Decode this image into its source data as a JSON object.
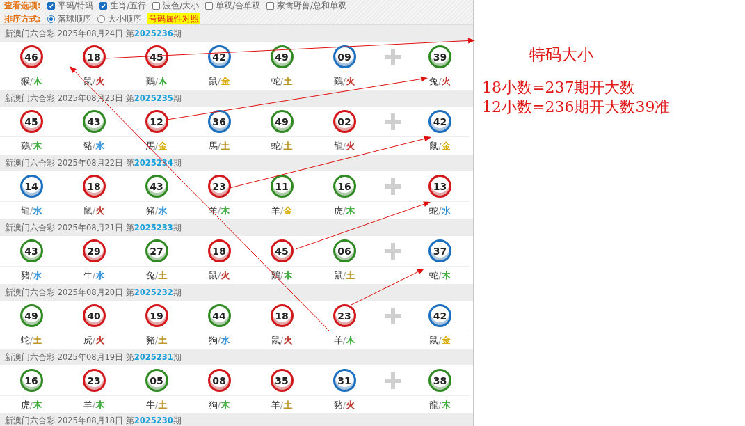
{
  "options": {
    "view_label": "查看选项:",
    "view_options": [
      {
        "label": "平码/特码",
        "checked": true
      },
      {
        "label": "生肖/五行",
        "checked": true
      },
      {
        "label": "波色/大小",
        "checked": false
      },
      {
        "label": "单双/合单双",
        "checked": false
      },
      {
        "label": "家禽野兽/总和单双",
        "checked": false
      }
    ],
    "sort_label": "排序方式:",
    "sort_options": [
      {
        "label": "落球顺序",
        "selected": true
      },
      {
        "label": "大小顺序",
        "selected": false
      }
    ],
    "reference_link": "号码属性对照"
  },
  "draws": [
    {
      "title": "新澳门六合彩 2025年08月24日 ",
      "issue_prefix": "第",
      "issue": "2025236",
      "issue_suffix": "期",
      "balls": [
        {
          "number": "46",
          "color": "#d3181c",
          "zodiac": "猴",
          "separator": "/",
          "element": {
            "text": "木",
            "color": "#3fae3f"
          }
        },
        {
          "number": "18",
          "color": "#d3181c",
          "zodiac": "鼠",
          "separator": "/",
          "element": {
            "text": "火",
            "color": "#c0302a"
          }
        },
        {
          "number": "45",
          "color": "#d3181c",
          "zodiac": "鷄",
          "separator": "/",
          "element": {
            "text": "木",
            "color": "#3fae3f"
          }
        },
        {
          "number": "42",
          "color": "#1b6fbf",
          "zodiac": "鼠",
          "separator": "/",
          "element": {
            "text": "金",
            "color": "#d9a900"
          }
        },
        {
          "number": "49",
          "color": "#2f8a22",
          "zodiac": "蛇",
          "separator": "/",
          "element": {
            "text": "土",
            "color": "#b8921c"
          }
        },
        {
          "number": "09",
          "color": "#1b6fbf",
          "zodiac": "鷄",
          "separator": "/",
          "element": {
            "text": "火",
            "color": "#c0302a"
          }
        }
      ],
      "special": {
        "number": "39",
        "color": "#2f8a22",
        "zodiac": "兔",
        "separator": "/",
        "element": {
          "text": "火",
          "color": "#c0302a"
        }
      }
    },
    {
      "title": "新澳门六合彩 2025年08月23日 ",
      "issue_prefix": "第",
      "issue": "2025235",
      "issue_suffix": "期",
      "balls": [
        {
          "number": "45",
          "color": "#d3181c",
          "zodiac": "鷄",
          "separator": "/",
          "element": {
            "text": "木",
            "color": "#3fae3f"
          }
        },
        {
          "number": "43",
          "color": "#2f8a22",
          "zodiac": "豬",
          "separator": "/",
          "element": {
            "text": "水",
            "color": "#2f8fd8"
          }
        },
        {
          "number": "12",
          "color": "#d3181c",
          "zodiac": "馬",
          "separator": "/",
          "element": {
            "text": "金",
            "color": "#d9a900"
          }
        },
        {
          "number": "36",
          "color": "#1b6fbf",
          "zodiac": "馬",
          "separator": "/",
          "element": {
            "text": "土",
            "color": "#b8921c"
          }
        },
        {
          "number": "49",
          "color": "#2f8a22",
          "zodiac": "蛇",
          "separator": "/",
          "element": {
            "text": "土",
            "color": "#b8921c"
          }
        },
        {
          "number": "02",
          "color": "#d3181c",
          "zodiac": "龍",
          "separator": "/",
          "element": {
            "text": "火",
            "color": "#c0302a"
          }
        }
      ],
      "special": {
        "number": "42",
        "color": "#1b6fbf",
        "zodiac": "鼠",
        "separator": "/",
        "element": {
          "text": "金",
          "color": "#d9a900"
        }
      }
    },
    {
      "title": "新澳门六合彩 2025年08月22日 ",
      "issue_prefix": "第",
      "issue": "2025234",
      "issue_suffix": "期",
      "balls": [
        {
          "number": "14",
          "color": "#1b6fbf",
          "zodiac": "龍",
          "separator": "/",
          "element": {
            "text": "水",
            "color": "#2f8fd8"
          }
        },
        {
          "number": "18",
          "color": "#d3181c",
          "zodiac": "鼠",
          "separator": "/",
          "element": {
            "text": "火",
            "color": "#c0302a"
          }
        },
        {
          "number": "43",
          "color": "#2f8a22",
          "zodiac": "豬",
          "separator": "/",
          "element": {
            "text": "水",
            "color": "#2f8fd8"
          }
        },
        {
          "number": "23",
          "color": "#d3181c",
          "zodiac": "羊",
          "separator": "/",
          "element": {
            "text": "木",
            "color": "#3fae3f"
          }
        },
        {
          "number": "11",
          "color": "#2f8a22",
          "zodiac": "羊",
          "separator": "/",
          "element": {
            "text": "金",
            "color": "#d9a900"
          }
        },
        {
          "number": "16",
          "color": "#2f8a22",
          "zodiac": "虎",
          "separator": "/",
          "element": {
            "text": "木",
            "color": "#3fae3f"
          }
        }
      ],
      "special": {
        "number": "13",
        "color": "#d3181c",
        "zodiac": "蛇",
        "separator": "/",
        "element": {
          "text": "水",
          "color": "#2f8fd8"
        }
      }
    },
    {
      "title": "新澳门六合彩 2025年08月21日 ",
      "issue_prefix": "第",
      "issue": "2025233",
      "issue_suffix": "期",
      "balls": [
        {
          "number": "43",
          "color": "#2f8a22",
          "zodiac": "豬",
          "separator": "/",
          "element": {
            "text": "水",
            "color": "#2f8fd8"
          }
        },
        {
          "number": "29",
          "color": "#d3181c",
          "zodiac": "牛",
          "separator": "/",
          "element": {
            "text": "水",
            "color": "#2f8fd8"
          }
        },
        {
          "number": "27",
          "color": "#2f8a22",
          "zodiac": "兔",
          "separator": "/",
          "element": {
            "text": "土",
            "color": "#b8921c"
          }
        },
        {
          "number": "18",
          "color": "#d3181c",
          "zodiac": "鼠",
          "separator": "/",
          "element": {
            "text": "火",
            "color": "#c0302a"
          }
        },
        {
          "number": "45",
          "color": "#d3181c",
          "zodiac": "鷄",
          "separator": "/",
          "element": {
            "text": "木",
            "color": "#3fae3f"
          }
        },
        {
          "number": "06",
          "color": "#2f8a22",
          "zodiac": "鼠",
          "separator": "/",
          "element": {
            "text": "土",
            "color": "#b8921c"
          }
        }
      ],
      "special": {
        "number": "37",
        "color": "#1b6fbf",
        "zodiac": "蛇",
        "separator": "/",
        "element": {
          "text": "木",
          "color": "#3fae3f"
        }
      }
    },
    {
      "title": "新澳门六合彩 2025年08月20日 ",
      "issue_prefix": "第",
      "issue": "2025232",
      "issue_suffix": "期",
      "balls": [
        {
          "number": "49",
          "color": "#2f8a22",
          "zodiac": "蛇",
          "separator": "/",
          "element": {
            "text": "土",
            "color": "#b8921c"
          }
        },
        {
          "number": "40",
          "color": "#d3181c",
          "zodiac": "虎",
          "separator": "/",
          "element": {
            "text": "火",
            "color": "#c0302a"
          }
        },
        {
          "number": "19",
          "color": "#d3181c",
          "zodiac": "豬",
          "separator": "/",
          "element": {
            "text": "土",
            "color": "#b8921c"
          }
        },
        {
          "number": "44",
          "color": "#2f8a22",
          "zodiac": "狗",
          "separator": "/",
          "element": {
            "text": "水",
            "color": "#2f8fd8"
          }
        },
        {
          "number": "18",
          "color": "#d3181c",
          "zodiac": "鼠",
          "separator": "/",
          "element": {
            "text": "火",
            "color": "#c0302a"
          }
        },
        {
          "number": "23",
          "color": "#d3181c",
          "zodiac": "羊",
          "separator": "/",
          "element": {
            "text": "木",
            "color": "#3fae3f"
          }
        }
      ],
      "special": {
        "number": "42",
        "color": "#1b6fbf",
        "zodiac": "鼠",
        "separator": "/",
        "element": {
          "text": "金",
          "color": "#d9a900"
        }
      }
    },
    {
      "title": "新澳门六合彩 2025年08月19日 ",
      "issue_prefix": "第",
      "issue": "2025231",
      "issue_suffix": "期",
      "balls": [
        {
          "number": "16",
          "color": "#2f8a22",
          "zodiac": "虎",
          "separator": "/",
          "element": {
            "text": "木",
            "color": "#3fae3f"
          }
        },
        {
          "number": "23",
          "color": "#d3181c",
          "zodiac": "羊",
          "separator": "/",
          "element": {
            "text": "木",
            "color": "#3fae3f"
          }
        },
        {
          "number": "05",
          "color": "#2f8a22",
          "zodiac": "牛",
          "separator": "/",
          "element": {
            "text": "土",
            "color": "#b8921c"
          }
        },
        {
          "number": "08",
          "color": "#d3181c",
          "zodiac": "狗",
          "separator": "/",
          "element": {
            "text": "木",
            "color": "#3fae3f"
          }
        },
        {
          "number": "35",
          "color": "#d3181c",
          "zodiac": "羊",
          "separator": "/",
          "element": {
            "text": "土",
            "color": "#b8921c"
          }
        },
        {
          "number": "31",
          "color": "#1b6fbf",
          "zodiac": "豬",
          "separator": "/",
          "element": {
            "text": "火",
            "color": "#c0302a"
          }
        }
      ],
      "special": {
        "number": "38",
        "color": "#2f8a22",
        "zodiac": "龍",
        "separator": "/",
        "element": {
          "text": "木",
          "color": "#3fae3f"
        }
      }
    },
    {
      "title": "新澳门六合彩 2025年08月18日 ",
      "issue_prefix": "第",
      "issue": "2025230",
      "issue_suffix": "期"
    }
  ],
  "annotation": {
    "title": "特码大小",
    "notes": [
      "18小数=237期开大数",
      "12小数=236期开大数39准"
    ]
  }
}
